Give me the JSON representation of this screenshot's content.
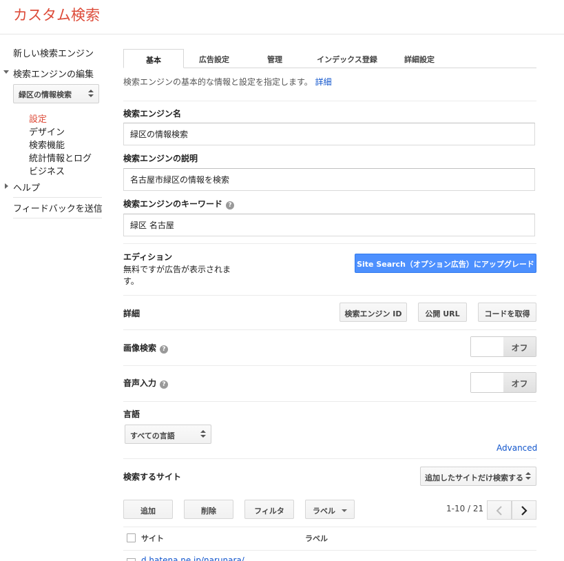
{
  "app_title": "カスタム検索",
  "sidebar": {
    "new_engine": "新しい検索エンジン",
    "edit_engine": "検索エンジンの編集",
    "engine_select": "緑区の情報検索",
    "sub_items": [
      "設定",
      "デザイン",
      "検索機能",
      "統計情報とログ",
      "ビジネス"
    ],
    "help": "ヘルプ",
    "feedback": "フィードバックを送信"
  },
  "tabs": [
    "基本",
    "広告設定",
    "管理",
    "インデックス登録",
    "詳細設定"
  ],
  "description": "検索エンジンの基本的な情報と設定を指定します。",
  "description_link": "詳細",
  "fields": {
    "name_label": "検索エンジン名",
    "name_value": "緑区の情報検索",
    "desc_label": "検索エンジンの説明",
    "desc_value": "名古屋市緑区の情報を検索",
    "keyword_label": "検索エンジンのキーワード",
    "keyword_value": "緑区 名古屋"
  },
  "edition": {
    "label": "エディション",
    "note": "無料ですが広告が表示されます。",
    "upgrade_button": "Site Search（オプション広告）にアップグレード"
  },
  "details": {
    "label": "詳細",
    "engine_id_button": "検索エンジン ID",
    "public_url_button": "公開 URL",
    "get_code_button": "コードを取得"
  },
  "image_search": {
    "label": "画像検索",
    "state": "オフ"
  },
  "voice_input": {
    "label": "音声入力",
    "state": "オフ"
  },
  "language": {
    "label": "言語",
    "selected": "すべての言語"
  },
  "advanced_link": "Advanced",
  "sites": {
    "label": "検索するサイト",
    "filter_select": "追加したサイトだけ検索する",
    "add_button": "追加",
    "delete_button": "削除",
    "filter_button": "フィルタ",
    "label_button": "ラベル",
    "pager": "1-10 / 21",
    "col_site": "サイト",
    "col_label": "ラベル",
    "first_row": "d.hatena.ne.jp/narunara/"
  }
}
